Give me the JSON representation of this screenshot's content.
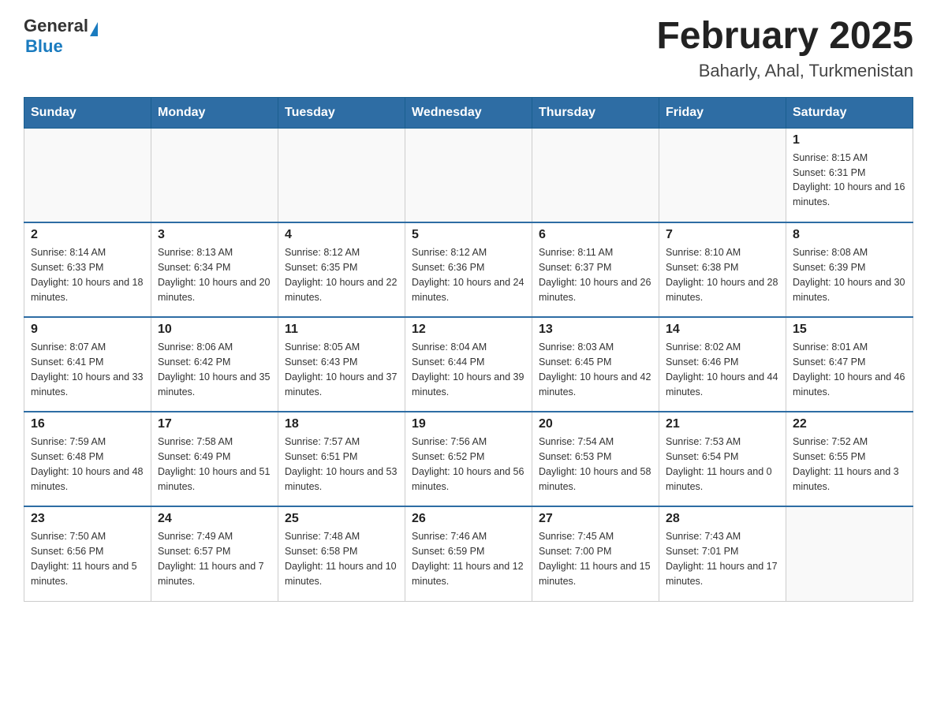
{
  "header": {
    "logo": {
      "general": "General",
      "blue": "Blue",
      "triangle": true
    },
    "title": "February 2025",
    "location": "Baharly, Ahal, Turkmenistan"
  },
  "weekdays": [
    "Sunday",
    "Monday",
    "Tuesday",
    "Wednesday",
    "Thursday",
    "Friday",
    "Saturday"
  ],
  "weeks": [
    [
      {
        "day": "",
        "info": ""
      },
      {
        "day": "",
        "info": ""
      },
      {
        "day": "",
        "info": ""
      },
      {
        "day": "",
        "info": ""
      },
      {
        "day": "",
        "info": ""
      },
      {
        "day": "",
        "info": ""
      },
      {
        "day": "1",
        "info": "Sunrise: 8:15 AM\nSunset: 6:31 PM\nDaylight: 10 hours and 16 minutes."
      }
    ],
    [
      {
        "day": "2",
        "info": "Sunrise: 8:14 AM\nSunset: 6:33 PM\nDaylight: 10 hours and 18 minutes."
      },
      {
        "day": "3",
        "info": "Sunrise: 8:13 AM\nSunset: 6:34 PM\nDaylight: 10 hours and 20 minutes."
      },
      {
        "day": "4",
        "info": "Sunrise: 8:12 AM\nSunset: 6:35 PM\nDaylight: 10 hours and 22 minutes."
      },
      {
        "day": "5",
        "info": "Sunrise: 8:12 AM\nSunset: 6:36 PM\nDaylight: 10 hours and 24 minutes."
      },
      {
        "day": "6",
        "info": "Sunrise: 8:11 AM\nSunset: 6:37 PM\nDaylight: 10 hours and 26 minutes."
      },
      {
        "day": "7",
        "info": "Sunrise: 8:10 AM\nSunset: 6:38 PM\nDaylight: 10 hours and 28 minutes."
      },
      {
        "day": "8",
        "info": "Sunrise: 8:08 AM\nSunset: 6:39 PM\nDaylight: 10 hours and 30 minutes."
      }
    ],
    [
      {
        "day": "9",
        "info": "Sunrise: 8:07 AM\nSunset: 6:41 PM\nDaylight: 10 hours and 33 minutes."
      },
      {
        "day": "10",
        "info": "Sunrise: 8:06 AM\nSunset: 6:42 PM\nDaylight: 10 hours and 35 minutes."
      },
      {
        "day": "11",
        "info": "Sunrise: 8:05 AM\nSunset: 6:43 PM\nDaylight: 10 hours and 37 minutes."
      },
      {
        "day": "12",
        "info": "Sunrise: 8:04 AM\nSunset: 6:44 PM\nDaylight: 10 hours and 39 minutes."
      },
      {
        "day": "13",
        "info": "Sunrise: 8:03 AM\nSunset: 6:45 PM\nDaylight: 10 hours and 42 minutes."
      },
      {
        "day": "14",
        "info": "Sunrise: 8:02 AM\nSunset: 6:46 PM\nDaylight: 10 hours and 44 minutes."
      },
      {
        "day": "15",
        "info": "Sunrise: 8:01 AM\nSunset: 6:47 PM\nDaylight: 10 hours and 46 minutes."
      }
    ],
    [
      {
        "day": "16",
        "info": "Sunrise: 7:59 AM\nSunset: 6:48 PM\nDaylight: 10 hours and 48 minutes."
      },
      {
        "day": "17",
        "info": "Sunrise: 7:58 AM\nSunset: 6:49 PM\nDaylight: 10 hours and 51 minutes."
      },
      {
        "day": "18",
        "info": "Sunrise: 7:57 AM\nSunset: 6:51 PM\nDaylight: 10 hours and 53 minutes."
      },
      {
        "day": "19",
        "info": "Sunrise: 7:56 AM\nSunset: 6:52 PM\nDaylight: 10 hours and 56 minutes."
      },
      {
        "day": "20",
        "info": "Sunrise: 7:54 AM\nSunset: 6:53 PM\nDaylight: 10 hours and 58 minutes."
      },
      {
        "day": "21",
        "info": "Sunrise: 7:53 AM\nSunset: 6:54 PM\nDaylight: 11 hours and 0 minutes."
      },
      {
        "day": "22",
        "info": "Sunrise: 7:52 AM\nSunset: 6:55 PM\nDaylight: 11 hours and 3 minutes."
      }
    ],
    [
      {
        "day": "23",
        "info": "Sunrise: 7:50 AM\nSunset: 6:56 PM\nDaylight: 11 hours and 5 minutes."
      },
      {
        "day": "24",
        "info": "Sunrise: 7:49 AM\nSunset: 6:57 PM\nDaylight: 11 hours and 7 minutes."
      },
      {
        "day": "25",
        "info": "Sunrise: 7:48 AM\nSunset: 6:58 PM\nDaylight: 11 hours and 10 minutes."
      },
      {
        "day": "26",
        "info": "Sunrise: 7:46 AM\nSunset: 6:59 PM\nDaylight: 11 hours and 12 minutes."
      },
      {
        "day": "27",
        "info": "Sunrise: 7:45 AM\nSunset: 7:00 PM\nDaylight: 11 hours and 15 minutes."
      },
      {
        "day": "28",
        "info": "Sunrise: 7:43 AM\nSunset: 7:01 PM\nDaylight: 11 hours and 17 minutes."
      },
      {
        "day": "",
        "info": ""
      }
    ]
  ]
}
